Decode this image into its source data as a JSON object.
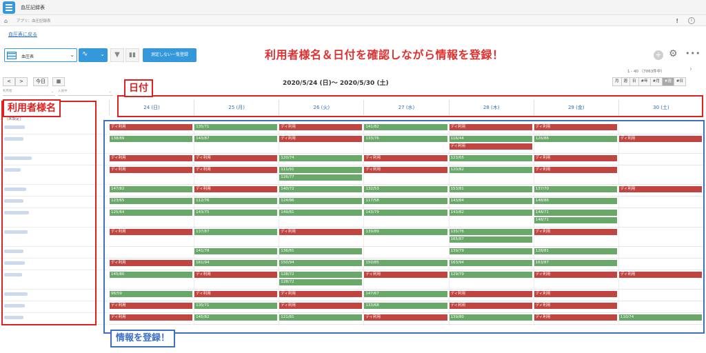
{
  "app": {
    "title": "血圧記録表"
  },
  "breadcrumb": {
    "text": "アプリ：血圧記録表"
  },
  "topbar": {
    "excl": "!",
    "info": "i"
  },
  "back_link": "血圧表に戻る",
  "toolbar": {
    "view_name": "血圧表",
    "unmeasured_button": "測定しない一覧登録",
    "headline": "利用者様名＆日付を確認しながら情報を登録！",
    "plus": "+",
    "paging": "1 - 40 （7063件中）"
  },
  "calendar": {
    "prev": "<",
    "next": ">",
    "today": "今日",
    "range_title": "2020/5/24 (日)～ 2020/5/30 (土)",
    "view_tabs": [
      "月",
      "週",
      "日",
      "#年",
      "#月",
      "#週",
      "#日"
    ],
    "active_tab_index": 5,
    "filter_1": "利用者",
    "filter_2": "入居中",
    "days": [
      "24 (日)",
      "25 (月)",
      "26 (火)",
      "27 (水)",
      "28 (木)",
      "29 (金)",
      "30 (土)"
    ],
    "unset_label": "(未設定)"
  },
  "annotations": {
    "date_label": "日付",
    "name_label": "利用者様名",
    "info_label": "情報を登録！"
  },
  "rows": [
    {
      "cells": [
        [
          {
            "t": "ディ利用",
            "k": "day"
          }
        ],
        [
          {
            "t": "135/71",
            "k": "bp"
          }
        ],
        [
          {
            "t": "ディ利用",
            "k": "day"
          }
        ],
        [
          {
            "t": "141/82",
            "k": "bp"
          }
        ],
        [
          {
            "t": "ディ利用",
            "k": "day"
          }
        ],
        [
          {
            "t": "ディ利用",
            "k": "day"
          }
        ],
        []
      ]
    },
    {
      "cells": [
        [
          {
            "t": "138/89",
            "k": "bp"
          }
        ],
        [
          {
            "t": "143/87",
            "k": "bp"
          }
        ],
        [
          {
            "t": "ディ利用",
            "k": "day"
          }
        ],
        [
          {
            "t": "133/76",
            "k": "bp"
          }
        ],
        [
          {
            "t": "116/44",
            "k": "bp"
          },
          {
            "t": "ディ利用",
            "k": "day"
          }
        ],
        [
          {
            "t": "126/86",
            "k": "bp"
          }
        ],
        [
          {
            "t": "ディ利用",
            "k": "day"
          }
        ]
      ]
    },
    {
      "cells": [
        [
          {
            "t": "ディ利用",
            "k": "day"
          }
        ],
        [
          {
            "t": "ディ利用",
            "k": "day"
          }
        ],
        [
          {
            "t": "120/74",
            "k": "bp"
          }
        ],
        [
          {
            "t": "ディ利用",
            "k": "day"
          }
        ],
        [
          {
            "t": "123/65",
            "k": "bp"
          }
        ],
        [
          {
            "t": "ディ利用",
            "k": "day"
          }
        ],
        []
      ]
    },
    {
      "cells": [
        [
          {
            "t": "ディ利用",
            "k": "day"
          }
        ],
        [
          {
            "t": "ディ利用",
            "k": "day"
          }
        ],
        [
          {
            "t": "111/91",
            "k": "bp"
          },
          {
            "t": "126/77",
            "k": "bp"
          }
        ],
        [
          {
            "t": "ディ利用",
            "k": "day"
          }
        ],
        [
          {
            "t": "120/82",
            "k": "bp"
          }
        ],
        [
          {
            "t": "ディ利用",
            "k": "day"
          }
        ],
        []
      ]
    },
    {
      "cells": [
        [
          {
            "t": "147/82",
            "k": "bp"
          }
        ],
        [
          {
            "t": "ディ利用",
            "k": "day"
          }
        ],
        [
          {
            "t": "140/72",
            "k": "bp"
          }
        ],
        [
          {
            "t": "132/53",
            "k": "bp"
          }
        ],
        [
          {
            "t": "153/81",
            "k": "bp"
          }
        ],
        [
          {
            "t": "137/70",
            "k": "bp"
          }
        ],
        [
          {
            "t": "ディ利用",
            "k": "day"
          }
        ]
      ]
    },
    {
      "cells": [
        [
          {
            "t": "123/65",
            "k": "bp"
          }
        ],
        [
          {
            "t": "112/76",
            "k": "bp"
          }
        ],
        [
          {
            "t": "124/86",
            "k": "bp"
          }
        ],
        [
          {
            "t": "117/58",
            "k": "bp"
          }
        ],
        [
          {
            "t": "143/84",
            "k": "bp"
          }
        ],
        [
          {
            "t": "148/86",
            "k": "bp"
          }
        ],
        []
      ]
    },
    {
      "cells": [
        [
          {
            "t": "125/64",
            "k": "bp"
          }
        ],
        [
          {
            "t": "143/75",
            "k": "bp"
          }
        ],
        [
          {
            "t": "149/81",
            "k": "bp"
          }
        ],
        [
          {
            "t": "143/79",
            "k": "bp"
          }
        ],
        [
          {
            "t": "143/82",
            "k": "bp"
          }
        ],
        [
          {
            "t": "148/71",
            "k": "bp"
          },
          {
            "t": "148/71",
            "k": "bp"
          }
        ],
        []
      ]
    },
    {
      "cells": [
        [
          {
            "t": "ディ利用",
            "k": "day"
          }
        ],
        [
          {
            "t": "137/87",
            "k": "bp"
          }
        ],
        [
          {
            "t": "ディ利用",
            "k": "day"
          }
        ],
        [
          {
            "t": "139/89",
            "k": "bp"
          }
        ],
        [
          {
            "t": "135/76",
            "k": "bp"
          },
          {
            "t": "165/87",
            "k": "bp"
          }
        ],
        [
          {
            "t": "ディ利用",
            "k": "day"
          }
        ],
        []
      ]
    },
    {
      "cells": [
        [],
        [
          {
            "t": "141/78",
            "k": "bp"
          }
        ],
        [
          {
            "t": "136/81",
            "k": "bp"
          }
        ],
        [],
        [
          {
            "t": "139/79",
            "k": "bp"
          }
        ],
        [
          {
            "t": "128/81",
            "k": "bp"
          }
        ],
        []
      ]
    },
    {
      "cells": [
        [
          {
            "t": "ディ利用",
            "k": "day"
          }
        ],
        [
          {
            "t": "161/94",
            "k": "bp"
          }
        ],
        [
          {
            "t": "150/94",
            "k": "bp"
          }
        ],
        [
          {
            "t": "150/85",
            "k": "bp"
          }
        ],
        [
          {
            "t": "163/94",
            "k": "bp"
          }
        ],
        [
          {
            "t": "163/87",
            "k": "bp"
          }
        ],
        []
      ]
    },
    {
      "cells": [
        [
          {
            "t": "145/80",
            "k": "bp"
          }
        ],
        [
          {
            "t": "ディ利用",
            "k": "day"
          }
        ],
        [
          {
            "t": "128/72",
            "k": "bp"
          },
          {
            "t": "128/72",
            "k": "bp"
          }
        ],
        [
          {
            "t": "ディ利用",
            "k": "day"
          }
        ],
        [
          {
            "t": "129/79",
            "k": "bp"
          }
        ],
        [
          {
            "t": "ディ利用",
            "k": "day"
          }
        ],
        [
          {
            "t": "ディ利用",
            "k": "day"
          }
        ]
      ]
    },
    {
      "cells": [
        [
          {
            "t": "96/59",
            "k": "bp"
          }
        ],
        [
          {
            "t": "ディ利用",
            "k": "day"
          }
        ],
        [
          {
            "t": "ディ利用",
            "k": "day"
          }
        ],
        [
          {
            "t": "147/67",
            "k": "bp"
          }
        ],
        [
          {
            "t": "ディ利用",
            "k": "day"
          }
        ],
        [
          {
            "t": "ディ利用",
            "k": "day"
          }
        ],
        []
      ]
    },
    {
      "cells": [
        [
          {
            "t": "ディ利用",
            "k": "day"
          }
        ],
        [
          {
            "t": "135/71",
            "k": "bp"
          }
        ],
        [
          {
            "t": "ディ利用",
            "k": "day"
          }
        ],
        [
          {
            "t": "133/68",
            "k": "bp"
          }
        ],
        [
          {
            "t": "ディ利用",
            "k": "day"
          }
        ],
        [
          {
            "t": "ディ利用",
            "k": "day"
          }
        ],
        []
      ]
    },
    {
      "cells": [
        [
          {
            "t": "ディ利用",
            "k": "day"
          }
        ],
        [
          {
            "t": "145/82",
            "k": "bp"
          }
        ],
        [
          {
            "t": "121/81",
            "k": "bp"
          }
        ],
        [
          {
            "t": "ディ利用",
            "k": "day"
          }
        ],
        [
          {
            "t": "139/80",
            "k": "bp"
          }
        ],
        [
          {
            "t": "ディ利用",
            "k": "day"
          }
        ],
        [
          {
            "t": "110/74",
            "k": "bp"
          }
        ]
      ]
    }
  ]
}
